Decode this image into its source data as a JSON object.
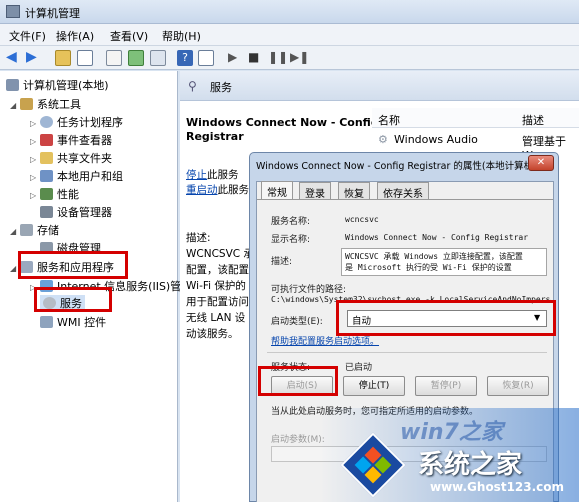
{
  "window": {
    "title": "计算机管理"
  },
  "menu": [
    "文件(F)",
    "操作(A)",
    "查看(V)",
    "帮助(H)"
  ],
  "tree": {
    "root": "计算机管理(本地)",
    "system_tools": "系统工具",
    "task_scheduler": "任务计划程序",
    "event_viewer": "事件查看器",
    "shared_folders": "共享文件夹",
    "local_users": "本地用户和组",
    "performance": "性能",
    "device_manager": "设备管理器",
    "storage": "存储",
    "disk_management": "磁盘管理",
    "services_apps": "服务和应用程序",
    "iis": "Internet 信息服务(IIS)管",
    "services": "服务",
    "wmi": "WMI 控件"
  },
  "pane": {
    "header": "服务",
    "service_title_line1": "Windows Connect Now - Config",
    "service_title_line2": "Registrar",
    "stop_link": "停止",
    "stop_suffix": "此服务",
    "restart_link": "重启动",
    "restart_suffix": "此服务",
    "desc_label": "描述:",
    "desc_lines": [
      "WCNCSVC 承",
      "配置，该配置",
      "Wi-Fi 保护的",
      "用于配置访问",
      "无线 LAN 设",
      "动该服务。"
    ],
    "col_name": "名称",
    "col_desc": "描述",
    "row1_name": "Windows Audio",
    "row1_desc": "管理基于 W"
  },
  "dialog": {
    "title": "Windows Connect Now - Config Registrar 的属性(本地计算机)",
    "tabs": [
      "常规",
      "登录",
      "恢复",
      "依存关系"
    ],
    "service_name_label": "服务名称:",
    "service_name": "wcncsvc",
    "display_name_label": "显示名称:",
    "display_name": "Windows Connect Now - Config Registrar",
    "desc_label": "描述:",
    "desc_line1": "WCNCSVC 承载 Windows 立即连接配置，该配置",
    "desc_line2": "是 Microsoft 执行的受 Wi-Fi 保护的设置",
    "path_label": "可执行文件的路径:",
    "path": "C:\\windows\\System32\\svchost.exe -k LocalServiceAndNoImpersor",
    "startup_label": "启动类型(E):",
    "startup_value": "自动",
    "help_link": "帮助我配置服务启动选项。",
    "status_label": "服务状态:",
    "status_value": "已启动",
    "btn_start": "启动(S)",
    "btn_stop": "停止(T)",
    "btn_pause": "暂停(P)",
    "btn_resume": "恢复(R)",
    "hint": "当从此处启动服务时，您可指定所适用的启动参数。",
    "params_label": "启动参数(M):"
  },
  "watermark": {
    "brand": "系统之家",
    "url": "www.Ghost123.com",
    "faint": "win7之家"
  },
  "colors": {
    "highlight": "#d40000",
    "link": "#0645ad"
  }
}
